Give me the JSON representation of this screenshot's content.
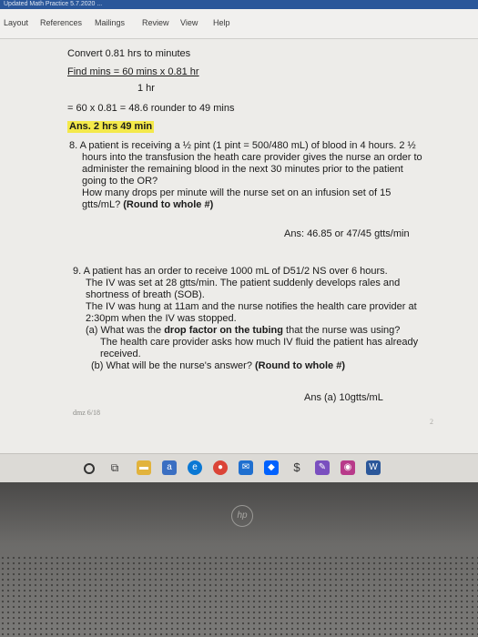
{
  "window": {
    "title": "Updated Math Practice 5.7.2020 ..."
  },
  "ribbon": {
    "tabs": [
      "Layout",
      "References",
      "Mailings",
      "Review",
      "View",
      "Help"
    ]
  },
  "doc": {
    "lines": [
      "Convert 0.81 hrs to minutes",
      "Find mins = 60 mins  x 0.81 hr",
      "1 hr",
      "= 60 x 0.81 = 48.6 rounder to 49 mins",
      "Ans. 2 hrs 49 min",
      "8.  A patient is receiving a ½ pint (1 pint = 500/480 mL) of blood in 4 hours.  2 ½",
      "hours into the transfusion the heath care provider gives the nurse an order to",
      "administer the remaining blood in the next 30 minutes prior to the patient",
      "going to the OR?",
      "How many drops per minute will the nurse set on an infusion set of 15",
      "gtts/mL?",
      "(Round to whole #)",
      "Ans: 46.85 or 47/45 gtts/min",
      "9.  A patient has an order to receive 1000 mL of D51/2 NS over 6 hours.",
      "The IV was set at 28 gtts/min.  The patient suddenly develops rales and",
      "shortness of breath (SOB).",
      "The IV was hung at 11am and the nurse notifies the health care provider at",
      "2:30pm when the IV was stopped.",
      "(a) What was the ",
      "drop factor on the tubing",
      " that the nurse was using?",
      "The health care provider asks how much IV fluid the patient has already",
      "received.",
      "(b) What will be the nurse's answer?",
      "(Round to whole #)",
      "Ans (a)  10gtts/mL",
      "dmz 6/18",
      "2"
    ]
  },
  "taskbar": {
    "icons": [
      "cortana-icon",
      "task-view-icon",
      "file-explorer-icon",
      "store-icon",
      "edge-icon",
      "chrome-icon",
      "mail-icon",
      "dropbox-icon",
      "cash-icon",
      "paint-icon",
      "photos-icon",
      "word-icon"
    ],
    "colors": {
      "word": "#2b579a",
      "chrome": "#db4437",
      "edge": "#0a78d4"
    }
  },
  "device": {
    "brand": "hp"
  }
}
